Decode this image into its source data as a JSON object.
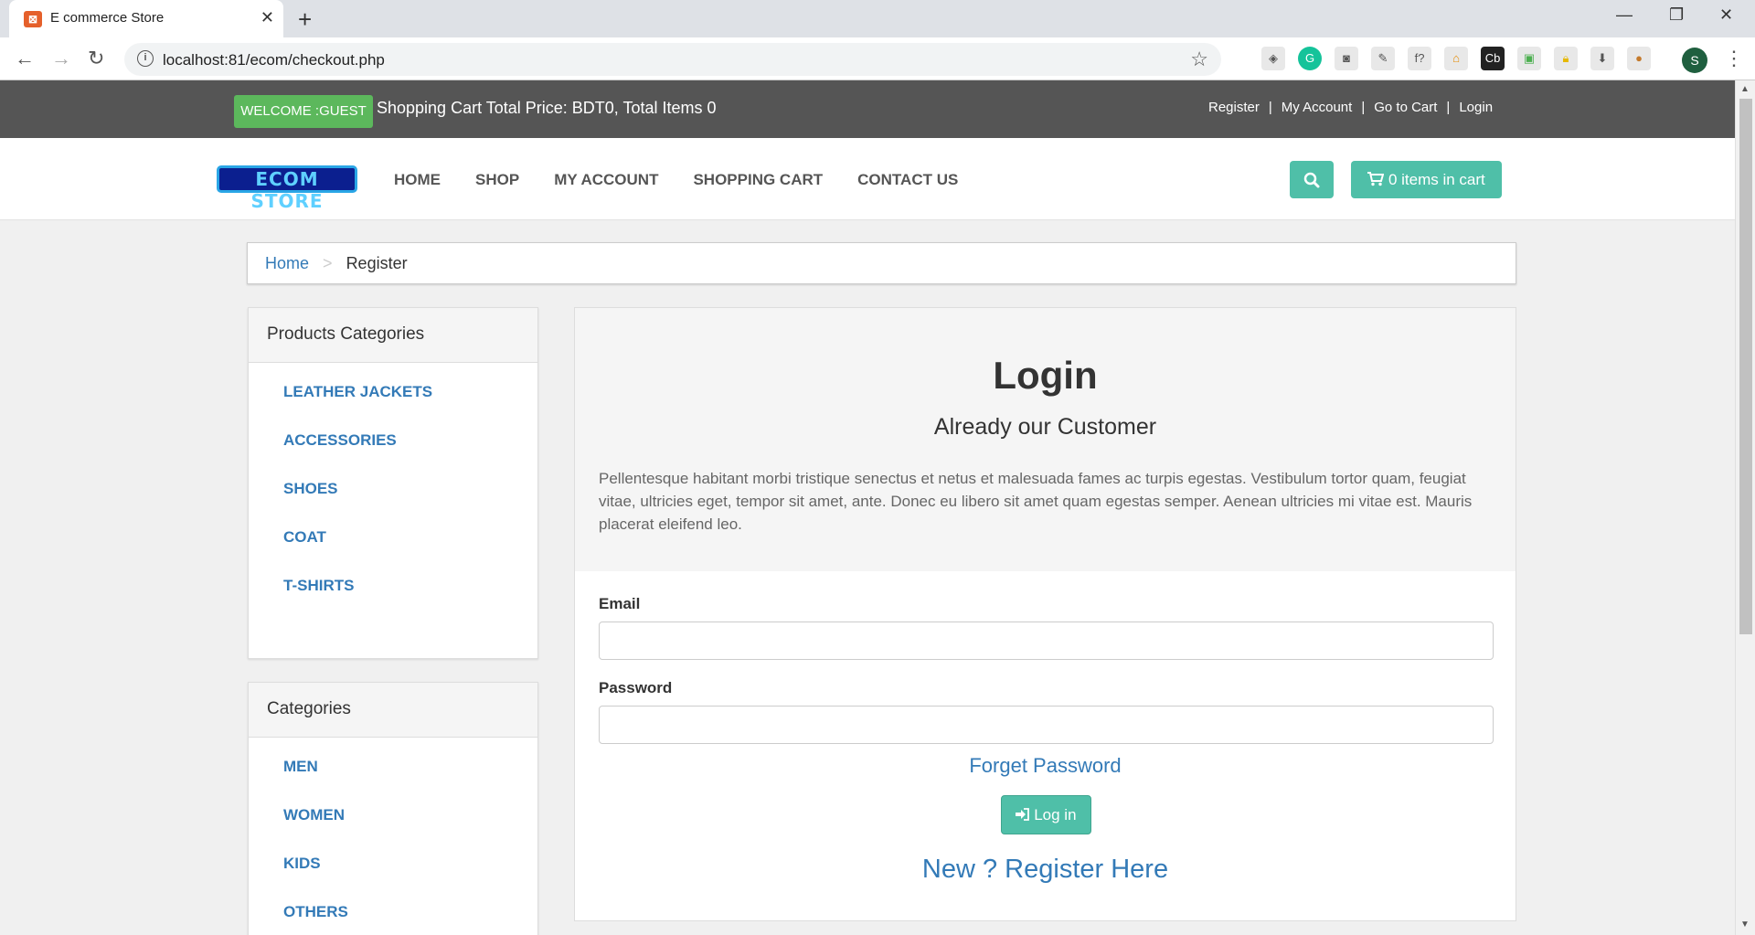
{
  "browser": {
    "tab_title": "E commerce Store",
    "url": "localhost:81/ecom/checkout.php",
    "profile_initial": "S",
    "extension_icons": [
      "extension-icon",
      "grammarly-icon",
      "camera-icon",
      "eyedropper-icon",
      "font-icon",
      "phpmyadmin-icon",
      "cb-icon",
      "image-icon",
      "lock-icon",
      "download-icon",
      "cookie-icon"
    ]
  },
  "topbar": {
    "welcome": "WELCOME :GUEST",
    "cart_summary": "Shopping Cart Total Price: BDT0, Total Items 0",
    "links": [
      "Register",
      "My Account",
      "Go to Cart",
      "Login"
    ],
    "separator": "|"
  },
  "nav": {
    "logo_text": "ECOM STORE",
    "menu": [
      "HOME",
      "SHOP",
      "MY ACCOUNT",
      "SHOPPING CART",
      "CONTACT US"
    ],
    "cart_button": "0 items in cart"
  },
  "breadcrumb": {
    "home": "Home",
    "separator": ">",
    "current": "Register"
  },
  "sidebar": {
    "product_categories": {
      "title": "Products Categories",
      "items": [
        "LEATHER JACKETS",
        "ACCESSORIES",
        "SHOES",
        "COAT",
        "T-SHIRTS"
      ]
    },
    "categories": {
      "title": "Categories",
      "items": [
        "MEN",
        "WOMEN",
        "KIDS",
        "OTHERS"
      ]
    }
  },
  "login": {
    "title": "Login",
    "subtitle": "Already our Customer",
    "description": "Pellentesque habitant morbi tristique senectus et netus et malesuada fames ac turpis egestas. Vestibulum tortor quam, feugiat vitae, ultricies eget, tempor sit amet, ante. Donec eu libero sit amet quam egestas semper. Aenean ultricies mi vitae est. Mauris placerat eleifend leo.",
    "email_label": "Email",
    "email_value": "",
    "password_label": "Password",
    "password_value": "",
    "forget_password": "Forget Password",
    "login_button": "Log in",
    "register_link": "New ? Register Here"
  },
  "colors": {
    "topbar_bg": "#555555",
    "welcome_badge": "#5cb85c",
    "accent": "#4fbfa8",
    "link": "#337ab7"
  }
}
